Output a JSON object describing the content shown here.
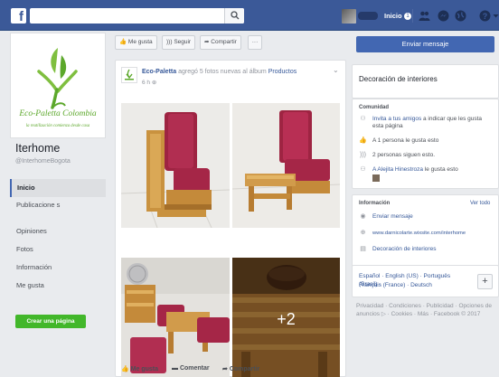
{
  "topbar": {
    "logo": "f",
    "search_placeholder": "",
    "home_label": "Inicio",
    "notif_count": "1",
    "colors": {
      "bar": "#3b5998"
    }
  },
  "sidebar": {
    "logo_title": "Eco-Paletta Colombia",
    "logo_tagline": "la reutilización comienza desde casa",
    "page_name": "Iterhome",
    "page_handle": "@InterhomeBogota",
    "items": [
      {
        "label": "Inicio"
      },
      {
        "label": "Publicacione s"
      },
      {
        "label": "Opiniones"
      },
      {
        "label": "Fotos"
      },
      {
        "label": "Información"
      },
      {
        "label": "Me gusta"
      }
    ],
    "create_page": "Crear una página"
  },
  "actions": {
    "like": "Me gusta",
    "follow": "Seguir",
    "share": "Compartir",
    "more": "···"
  },
  "post": {
    "author": "Eco-Paletta",
    "text_mid": "agregó 5 fotos nuevas al álbum",
    "album": "Productos",
    "time": "6 h",
    "more_photos": "+2",
    "like": "Me gusta",
    "comment": "Comentar",
    "share": "Compartir"
  },
  "right": {
    "send_message": "Enviar mensaje",
    "category": "Decoración de interiores",
    "community_title": "Comunidad",
    "community_rows": [
      {
        "icon": "invite-icon",
        "link": "Invita a tus amigos",
        "text": " a indicar que les gusta esta página"
      },
      {
        "icon": "thumb-icon",
        "link": "",
        "text": "A 1 persona le gusta esto"
      },
      {
        "icon": "rss-icon",
        "link": "",
        "text": "2 personas siguen esto."
      },
      {
        "icon": "friends-icon",
        "link": "A Alejita Hinestroza",
        "text": " le gusta esto"
      }
    ],
    "info_title": "Información",
    "see_all": "Ver todo",
    "info_rows": [
      {
        "icon": "messenger-icon",
        "text": "Enviar mensaje"
      },
      {
        "icon": "globe-icon",
        "text": "www.darnicolarte.wixsite.com/interhome"
      },
      {
        "icon": "tag-icon",
        "text": "Decoración de interiores"
      }
    ],
    "lang_line1": "Español · English (US) · Português (Brasil) ·",
    "lang_line2": "Français (France) · Deutsch",
    "plus": "+",
    "footer": "Privacidad · Condiciones · Publicidad · Opciones de anuncios ▷ · Cookies · Más · Facebook © 2017"
  }
}
